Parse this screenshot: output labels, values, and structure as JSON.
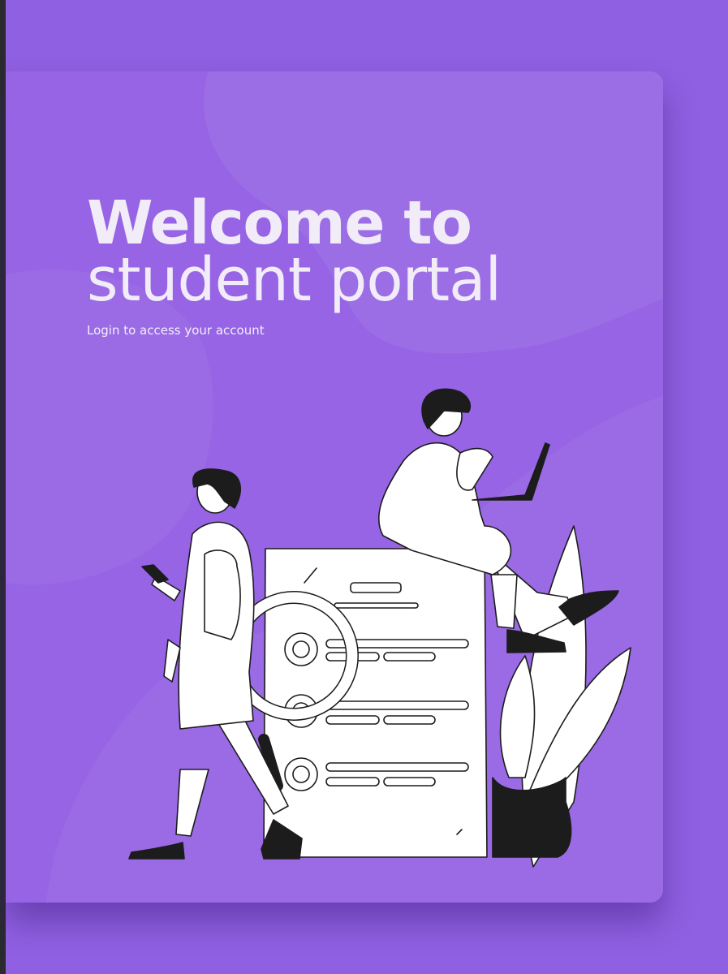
{
  "welcome": {
    "title_line1": "Welcome to",
    "title_line2": "student portal",
    "subtitle": "Login to access your account"
  },
  "colors": {
    "page_background": "#9060e2",
    "card_background": "#9664e4",
    "text": "#f1ecf7",
    "ink": "#1c1c1c"
  },
  "illustration": {
    "icons": [
      "person-standing-phone-icon",
      "person-sitting-laptop-icon",
      "document-icon",
      "magnifier-icon",
      "potted-plant-icon"
    ]
  }
}
